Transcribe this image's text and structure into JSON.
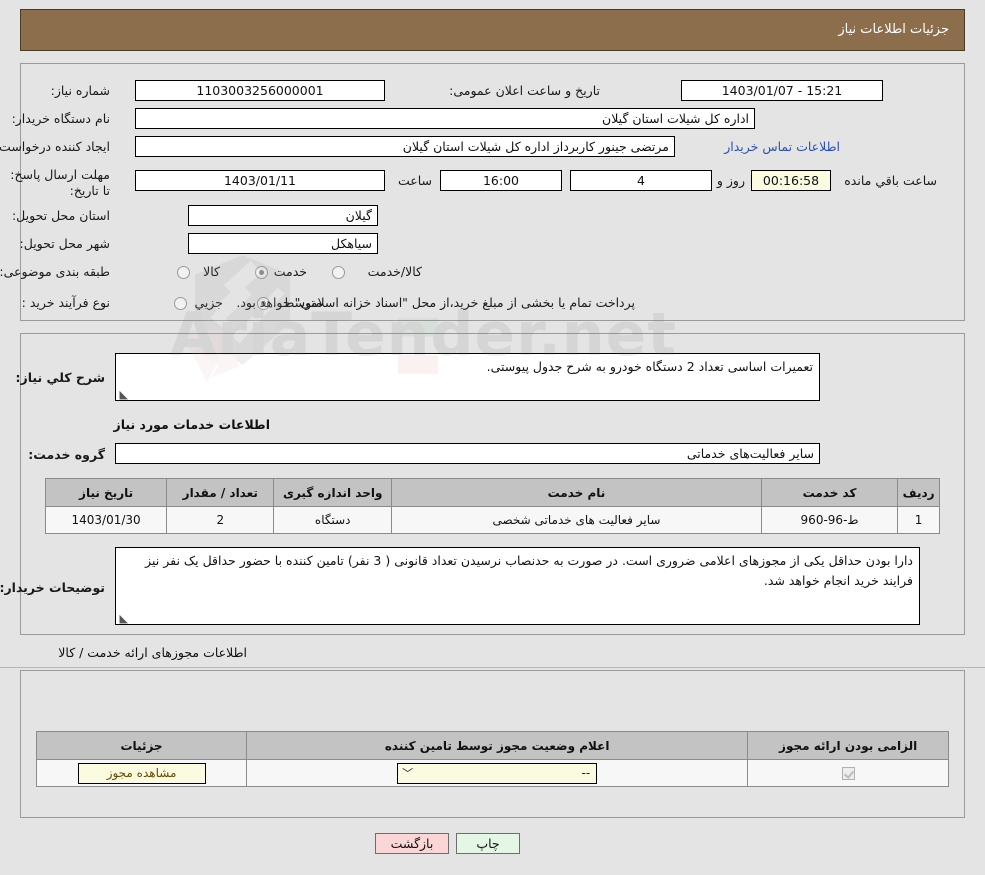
{
  "header": {
    "title": "جزئیات اطلاعات نیاز"
  },
  "top_form": {
    "need_number_label": "شماره نیاز:",
    "need_number_value": "1103003256000001",
    "announce_label": "تاریخ و ساعت اعلان عمومی:",
    "announce_value": "15:21 - 1403/01/07",
    "buyer_org_label": "نام دستگاه خریدار:",
    "buyer_org_value": "اداره کل شیلات استان گیلان",
    "creator_label": "ایجاد کننده درخواست:",
    "creator_value": "مرتضی جینور کاربرداز اداره کل شیلات استان گیلان",
    "contact_link": "اطلاعات تماس خریدار",
    "deadline_label": "مهلت ارسال پاسخ: تا تاریخ:",
    "deadline_date": "1403/01/11",
    "hour_label": "ساعت",
    "hour_value": "16:00",
    "days_value": "4",
    "days_label": "روز و",
    "countdown_value": "00:16:58",
    "countdown_label": "ساعت باقي مانده",
    "province_label": "استان محل تحویل:",
    "province_value": "گیلان",
    "city_label": "شهر محل تحویل:",
    "city_value": "سیاهکل",
    "category_label": "طبقه بندی موضوعی:",
    "category_options": [
      {
        "label": "کالا",
        "selected": false
      },
      {
        "label": "خدمت",
        "selected": true
      },
      {
        "label": "کالا/خدمت",
        "selected": false
      }
    ],
    "process_label": "نوع فرآیند خرید :",
    "process_options": [
      {
        "label": "جزیي",
        "selected": false
      },
      {
        "label": "متوسط",
        "selected": true
      }
    ],
    "payment_note": "پرداخت تمام یا بخشی از مبلغ خرید،از محل \"اسناد خزانه اسلامی\" خواهد بود."
  },
  "description": {
    "label": "شرح کلي نیاز:",
    "value": "تعمیرات اساسی تعداد 2 دستگاه خودرو به شرح جدول پیوستی."
  },
  "services_section": {
    "heading": "اطلاعات خدمات مورد نیاز",
    "group_label": "گروه خدمت:",
    "group_value": "سایر فعالیت‌های خدماتی"
  },
  "services_table": {
    "columns": [
      "ردیف",
      "کد خدمت",
      "نام خدمت",
      "واحد اندازه گیری",
      "تعداد / مقدار",
      "تاریخ نیاز"
    ],
    "rows": [
      {
        "row": "1",
        "code": "ط-96-960",
        "name": "سایر فعالیت های خدماتی شخصی",
        "unit": "دستگاه",
        "qty": "2",
        "date": "1403/01/30"
      }
    ]
  },
  "buyer_notes": {
    "label": "توضیحات خریدار:",
    "value": "دارا بودن حداقل یکی از مجوزهای اعلامی ضروری است. در صورت به حدنصاب نرسیدن تعداد قانونی ( 3 نفر) تامین کننده با حضور حداقل یک نفر نیز فرایند خرید انجام خواهد شد."
  },
  "permits_section": {
    "heading": "اطلاعات مجوزهای ارائه خدمت / کالا",
    "columns": [
      "الزامی بودن ارائه مجوز",
      "اعلام وضعیت مجوز توسط تامین کننده",
      "جزئیات"
    ],
    "rows": [
      {
        "required_checked": true,
        "status_value": "--",
        "details_button": "مشاهده مجوز"
      }
    ]
  },
  "footer": {
    "print_label": "چاپ",
    "back_label": "بازگشت"
  },
  "colors": {
    "header_bg": "#8d6e4c",
    "page_bg": "#e4e4e4",
    "link": "#2c4fb5",
    "print_btn": "#e4f7e4",
    "back_btn": "#fbd6d6",
    "highlight_field": "#fbfbe2"
  }
}
